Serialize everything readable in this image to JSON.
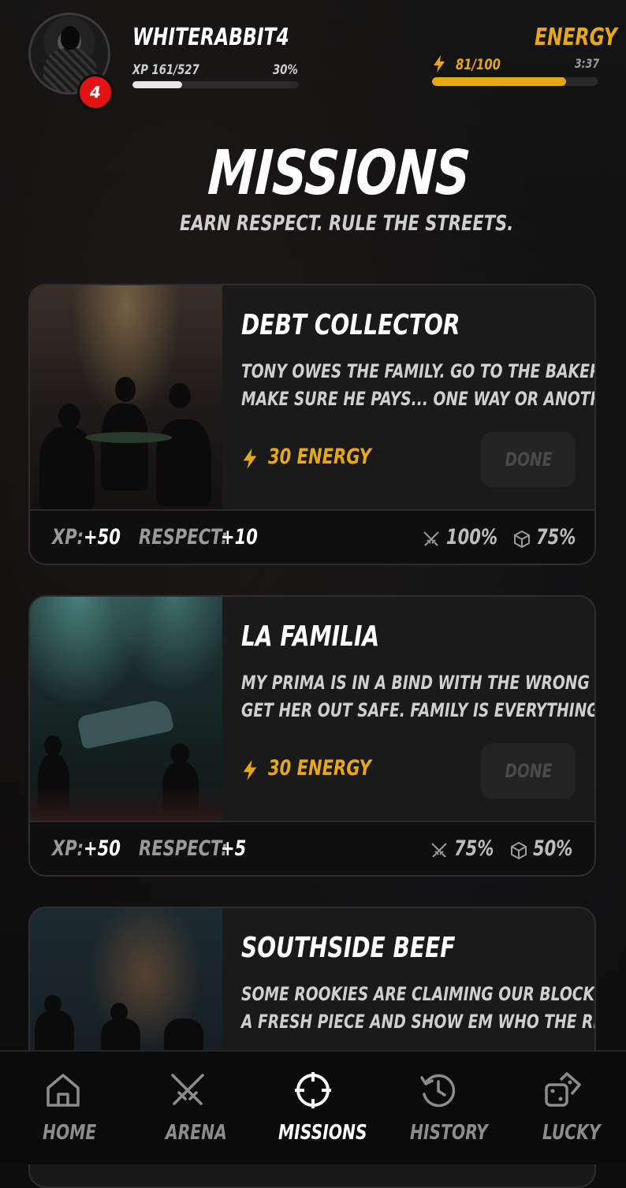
{
  "player": {
    "username": "WHITERABBIT4",
    "level": "4",
    "xp_label": "XP 161/527",
    "xp_percent_label": "30%",
    "xp_progress": 0.3
  },
  "energy": {
    "title": "ENERGY",
    "value_label": "81/100",
    "timer": "3:37",
    "progress": 0.81
  },
  "page": {
    "title": "MISSIONS",
    "subtitle": "EARN RESPECT. RULE THE STREETS."
  },
  "missions": [
    {
      "title": "DEBT COLLECTOR",
      "description_lines": [
        "TONY OWES THE FAMILY. GO TO THE BAKERY AND",
        "MAKE SURE HE PAYS... ONE WAY OR ANOTHER."
      ],
      "cost": "30 ENERGY",
      "button": "DONE",
      "xp_key": "XP:",
      "xp_value": "+50",
      "respect_key": "RESPECT:",
      "respect_value": "+10",
      "combat_chance": "100%",
      "loot_chance": "75%"
    },
    {
      "title": "LA FAMILIA",
      "description_lines": [
        "MY PRIMA IS IN A BIND WITH THE WRONG CREW.",
        "GET HER OUT SAFE. FAMILY IS EVERYTHING."
      ],
      "cost": "30 ENERGY",
      "button": "DONE",
      "xp_key": "XP:",
      "xp_value": "+50",
      "respect_key": "RESPECT:",
      "respect_value": "+5",
      "combat_chance": "75%",
      "loot_chance": "50%"
    },
    {
      "title": "SOUTHSIDE BEEF",
      "description_lines": [
        "SOME ROOKIES ARE CLAIMING OUR BLOCK. DROP",
        "A FRESH PIECE AND SHOW EM WHO THE REAL..."
      ]
    }
  ],
  "nav": {
    "items": [
      {
        "label": "HOME",
        "icon": "home-icon"
      },
      {
        "label": "ARENA",
        "icon": "crossed-swords-icon"
      },
      {
        "label": "MISSIONS",
        "icon": "crosshair-icon",
        "active": true
      },
      {
        "label": "HISTORY",
        "icon": "history-icon"
      },
      {
        "label": "LUCKY",
        "icon": "dice-icon"
      }
    ]
  },
  "colors": {
    "accent": "#e6a817",
    "level_badge": "#e11414",
    "background": "#0d0d0d"
  }
}
